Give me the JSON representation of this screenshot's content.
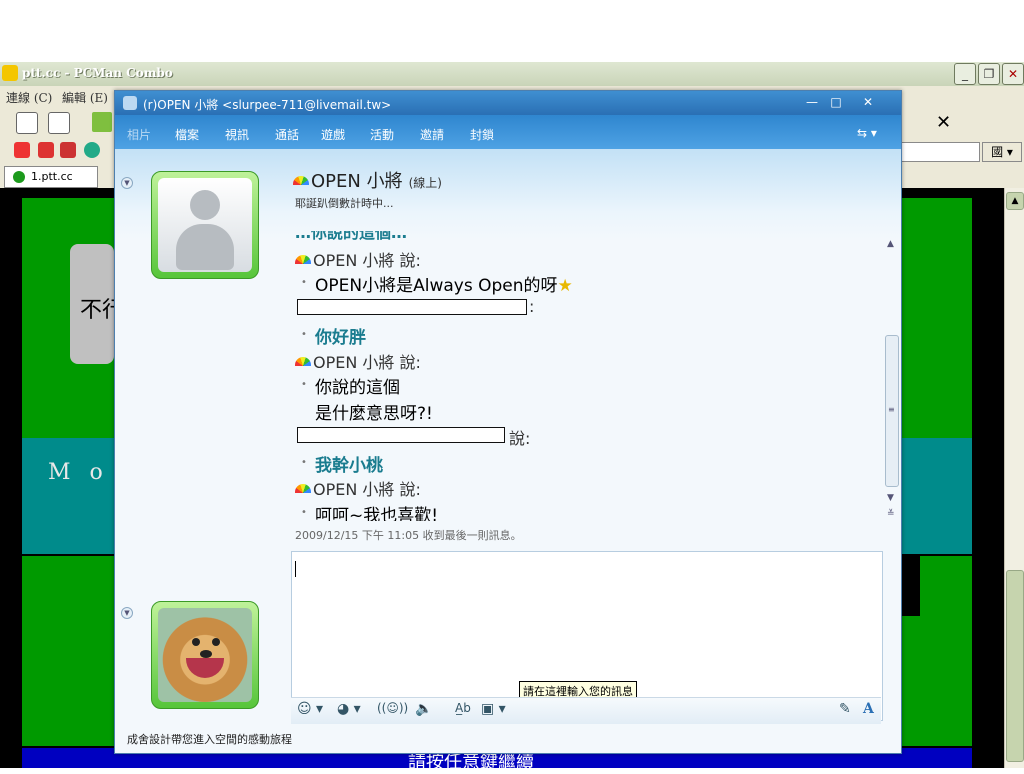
{
  "pcman": {
    "title": "ptt.cc - PCMan Combo",
    "menus": [
      "連線 (C)",
      "編輯 (E)"
    ],
    "tab_label": "1.ptt.cc",
    "address_button": "國 ▾",
    "toolbar_close": "✕"
  },
  "terminal": {
    "grey_text": "不行",
    "teal_text": "M o n",
    "bottom_text": "請按任意鍵繼續"
  },
  "msn": {
    "title": "(r)OPEN 小將 <slurpee-711@livemail.tw>",
    "menu": [
      "相片",
      "檔案",
      "視訊",
      "通話",
      "遊戲",
      "活動",
      "邀請",
      "封鎖"
    ],
    "menu_right_icon": "⇆ ▾",
    "contact": {
      "name": "OPEN 小將",
      "status": "(線上)",
      "personal_message": "耶誕趴倒數計時中..."
    },
    "conversation": {
      "partial_top": "…你說的這個…",
      "speaker_open": "OPEN 小將 說:",
      "speaker_me": "說:",
      "msg1": "OPEN小將是Always Open的呀",
      "msg1_emoticon": "★",
      "msg2": "你好胖",
      "msg3_line1": "你說的這個",
      "msg3_line2": "是什麼意思呀?!",
      "msg4": "我幹小桃",
      "msg5": "呵呵~我也喜歡!"
    },
    "timestamp": "2009/12/15 下午 11:05 收到最後一則訊息。",
    "input_tooltip": "請在這裡輸入您的訊息",
    "toolbar": {
      "emoticon": "☺ ▾",
      "wink": "◕ ▾",
      "nudge": "((☺))",
      "voice": "🔈",
      "font": "A̲b",
      "background": "▣ ▾",
      "pen": "✎",
      "font_btn": "A"
    },
    "footer_text": "成舍設計帶您進入空間的感動旅程"
  },
  "colors": {
    "msn_title": "#2a6fb4",
    "terminal_green": "#009a00",
    "terminal_teal": "#008b8b",
    "terminal_blue": "#0000c0",
    "msg_teal": "#1a7c8f"
  }
}
